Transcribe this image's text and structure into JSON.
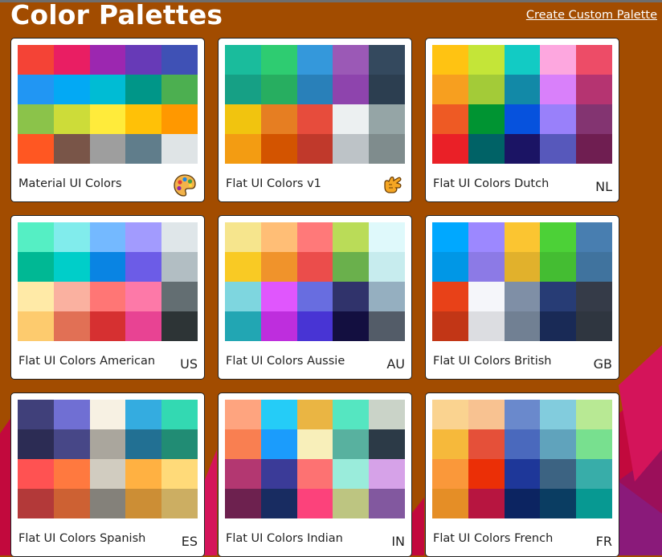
{
  "header": {
    "title": "Color Palettes",
    "create_link": "Create Custom Palette"
  },
  "palettes": [
    {
      "name": "Material UI Colors",
      "badge": "",
      "icon": "palette-icon",
      "colors": [
        "#f44336",
        "#e91e63",
        "#9c27b0",
        "#673ab7",
        "#3f51b5",
        "#2196f3",
        "#03a9f4",
        "#00bcd4",
        "#009688",
        "#4caf50",
        "#8bc34a",
        "#cddc39",
        "#ffeb3b",
        "#ffc107",
        "#ff9800",
        "#ff5722",
        "#795548",
        "#9e9e9e",
        "#607d8b",
        "#dfe4e6"
      ]
    },
    {
      "name": "Flat UI Colors v1",
      "badge": "",
      "icon": "hand-icon",
      "colors": [
        "#1abc9c",
        "#2ecc71",
        "#3498db",
        "#9b59b6",
        "#34495e",
        "#16a085",
        "#27ae60",
        "#2980b9",
        "#8e44ad",
        "#2c3e50",
        "#f1c40f",
        "#e67e22",
        "#e74c3c",
        "#ecf0f1",
        "#95a5a6",
        "#f39c12",
        "#d35400",
        "#c0392b",
        "#bdc3c7",
        "#7f8c8d"
      ]
    },
    {
      "name": "Flat UI Colors Dutch",
      "badge": "NL",
      "icon": "",
      "colors": [
        "#ffc312",
        "#c4e538",
        "#12cbc4",
        "#fda7df",
        "#ed4c67",
        "#f79f1f",
        "#a3cb38",
        "#1289a7",
        "#d980fa",
        "#b53471",
        "#ee5a24",
        "#009432",
        "#0652dd",
        "#9980fa",
        "#833471",
        "#ea2027",
        "#006266",
        "#1b1464",
        "#5758bb",
        "#6f1e51"
      ]
    },
    {
      "name": "Flat UI Colors American",
      "badge": "US",
      "icon": "",
      "colors": [
        "#55efc4",
        "#81ecec",
        "#74b9ff",
        "#a29bfe",
        "#dfe6e9",
        "#00b894",
        "#00cec9",
        "#0984e3",
        "#6c5ce7",
        "#b2bec3",
        "#ffeaa7",
        "#fab1a0",
        "#ff7675",
        "#fd79a8",
        "#636e72",
        "#fdcb6e",
        "#e17055",
        "#d63031",
        "#e84393",
        "#2d3436"
      ]
    },
    {
      "name": "Flat UI Colors Aussie",
      "badge": "AU",
      "icon": "",
      "colors": [
        "#f6e58d",
        "#ffbe76",
        "#ff7979",
        "#badc58",
        "#dff9fb",
        "#f9ca24",
        "#f0932b",
        "#eb4d4b",
        "#6ab04c",
        "#c7ecee",
        "#7ed6df",
        "#e056fd",
        "#686de0",
        "#30336b",
        "#95afc0",
        "#22a6b3",
        "#be2edd",
        "#4834d4",
        "#130f40",
        "#535c68"
      ]
    },
    {
      "name": "Flat UI Colors British",
      "badge": "GB",
      "icon": "",
      "colors": [
        "#00a8ff",
        "#9c88ff",
        "#fbc531",
        "#4cd137",
        "#487eb0",
        "#0097e6",
        "#8c7ae6",
        "#e1b12c",
        "#44bd32",
        "#40739e",
        "#e84118",
        "#f5f6fa",
        "#7f8fa6",
        "#273c75",
        "#353b48",
        "#c23616",
        "#dcdde1",
        "#718093",
        "#192a56",
        "#2f3640"
      ]
    },
    {
      "name": "Flat UI Colors Spanish",
      "badge": "ES",
      "icon": "",
      "colors": [
        "#40407a",
        "#706fd3",
        "#f7f1e3",
        "#34ace0",
        "#33d9b2",
        "#2c2c54",
        "#474787",
        "#aaa69d",
        "#227093",
        "#218c74",
        "#ff5252",
        "#ff793f",
        "#d1ccc0",
        "#ffb142",
        "#ffda79",
        "#b33939",
        "#cd6133",
        "#84817a",
        "#cc8e35",
        "#ccae62"
      ]
    },
    {
      "name": "Flat UI Colors Indian",
      "badge": "IN",
      "icon": "",
      "colors": [
        "#fea47f",
        "#25ccf7",
        "#eab543",
        "#55e6c1",
        "#cad3c8",
        "#f97f51",
        "#1b9cfc",
        "#f8efba",
        "#58b19f",
        "#2c3a47",
        "#b33771",
        "#3b3b98",
        "#fd7272",
        "#9aecdb",
        "#d6a2e8",
        "#6d214f",
        "#182c61",
        "#fc427b",
        "#bdc581",
        "#82589f"
      ]
    },
    {
      "name": "Flat UI Colors French",
      "badge": "FR",
      "icon": "",
      "colors": [
        "#fad390",
        "#f8c291",
        "#6a89cc",
        "#82ccdd",
        "#b8e994",
        "#f6b93b",
        "#e55039",
        "#4a69bd",
        "#60a3bc",
        "#78e08f",
        "#fa983a",
        "#eb2f06",
        "#1e3799",
        "#3c6382",
        "#38ada9",
        "#e58e26",
        "#b71540",
        "#0c2461",
        "#0a3d62",
        "#079992"
      ]
    }
  ]
}
